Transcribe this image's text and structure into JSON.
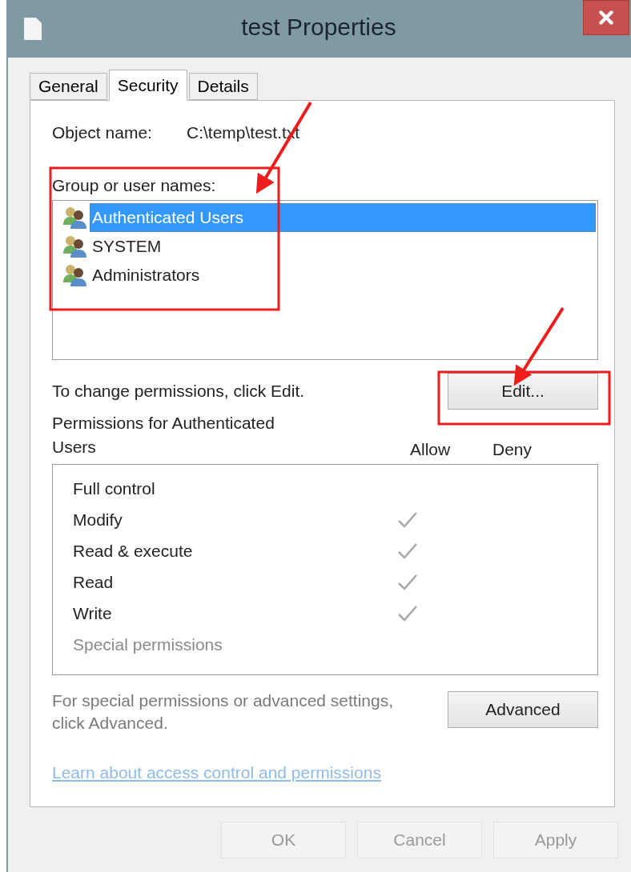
{
  "window": {
    "title": "test Properties"
  },
  "tabs": [
    {
      "label": "General",
      "selected": false
    },
    {
      "label": "Security",
      "selected": true
    },
    {
      "label": "Details",
      "selected": false
    }
  ],
  "object_name": {
    "label": "Object name:",
    "value": "C:\\temp\\test.txt"
  },
  "groups": {
    "label": "Group or user names:",
    "items": [
      {
        "name": "Authenticated Users",
        "selected": true
      },
      {
        "name": "SYSTEM",
        "selected": false
      },
      {
        "name": "Administrators",
        "selected": false
      }
    ]
  },
  "change_hint": "To change permissions, click Edit.",
  "edit_button": "Edit...",
  "permissions": {
    "label": "Permissions for Authenticated Users",
    "columns": [
      "Allow",
      "Deny"
    ],
    "rows": [
      {
        "name": "Full control",
        "allow": false,
        "deny": false,
        "disabled": false
      },
      {
        "name": "Modify",
        "allow": true,
        "deny": false,
        "disabled": false
      },
      {
        "name": "Read & execute",
        "allow": true,
        "deny": false,
        "disabled": false
      },
      {
        "name": "Read",
        "allow": true,
        "deny": false,
        "disabled": false
      },
      {
        "name": "Write",
        "allow": true,
        "deny": false,
        "disabled": false
      },
      {
        "name": "Special permissions",
        "allow": false,
        "deny": false,
        "disabled": true
      }
    ]
  },
  "advanced_hint": "For special permissions or advanced settings, click Advanced.",
  "advanced_button": "Advanced",
  "link": "Learn about access control and permissions",
  "buttons": [
    {
      "label": "OK",
      "disabled": true
    },
    {
      "label": "Cancel",
      "disabled": true
    },
    {
      "label": "Apply",
      "disabled": true
    }
  ],
  "annotations": [
    {
      "kind": "box"
    },
    {
      "kind": "arrow"
    },
    {
      "kind": "box"
    },
    {
      "kind": "arrow"
    }
  ]
}
